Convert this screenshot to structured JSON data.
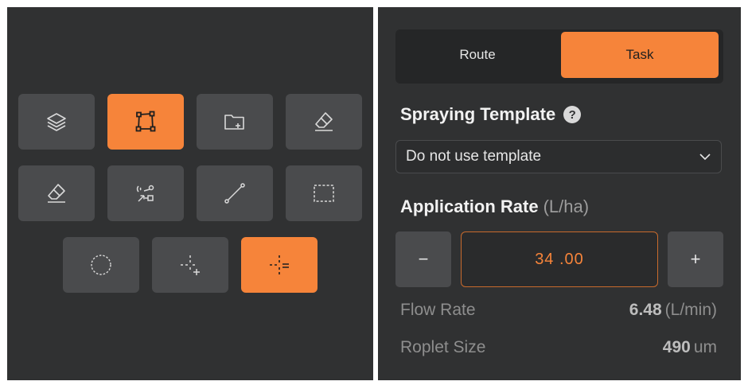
{
  "tools": [
    {
      "name": "layers-icon",
      "active": false
    },
    {
      "name": "polygon-icon",
      "active": true
    },
    {
      "name": "folder-add-icon",
      "active": false
    },
    {
      "name": "eraser-icon",
      "active": false
    },
    {
      "name": "eraser-icon",
      "active": false
    },
    {
      "name": "route-points-icon",
      "active": false
    },
    {
      "name": "line-icon",
      "active": false
    },
    {
      "name": "dashed-rectangle-icon",
      "active": false
    },
    {
      "name": "dashed-circle-icon",
      "active": false
    },
    {
      "name": "crosshair-add-icon",
      "active": false
    },
    {
      "name": "crosshair-remove-icon",
      "active": true
    }
  ],
  "tabs": {
    "route": "Route",
    "task": "Task",
    "active": "task"
  },
  "template": {
    "title": "Spraying Template",
    "help": "?",
    "selected": "Do not use template"
  },
  "application_rate": {
    "title": "Application Rate",
    "unit": "(L/ha)",
    "value": "34 .00",
    "minus": "−",
    "plus": "+"
  },
  "flow_rate": {
    "label": "Flow Rate",
    "value": "6.48",
    "unit": "(L/min)"
  },
  "droplet_size": {
    "label": "Roplet Size",
    "value": "490",
    "unit": "um"
  },
  "colors": {
    "accent": "#f6843a",
    "panel": "#303132",
    "button": "#4a4b4d"
  }
}
